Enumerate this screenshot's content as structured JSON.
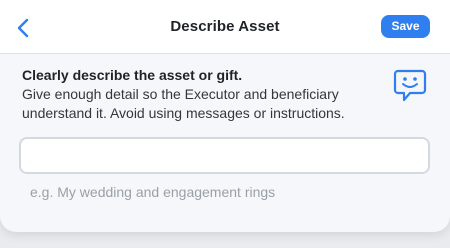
{
  "header": {
    "back_icon": "chevron-left-icon",
    "title": "Describe Asset",
    "save_label": "Save"
  },
  "main": {
    "heading": "Clearly describe the asset or gift.",
    "description": "Give enough detail so the Executor and beneficiary understand it. Avoid using messages or instructions.",
    "icon": "chat-smile-icon",
    "input": {
      "value": "",
      "placeholder": ""
    },
    "hint": "e.g. My wedding and engagement rings"
  },
  "colors": {
    "accent": "#2f7ff0",
    "background": "#f6f7fa",
    "header_bg": "#ffffff",
    "hint_text": "#9aa0a8"
  }
}
